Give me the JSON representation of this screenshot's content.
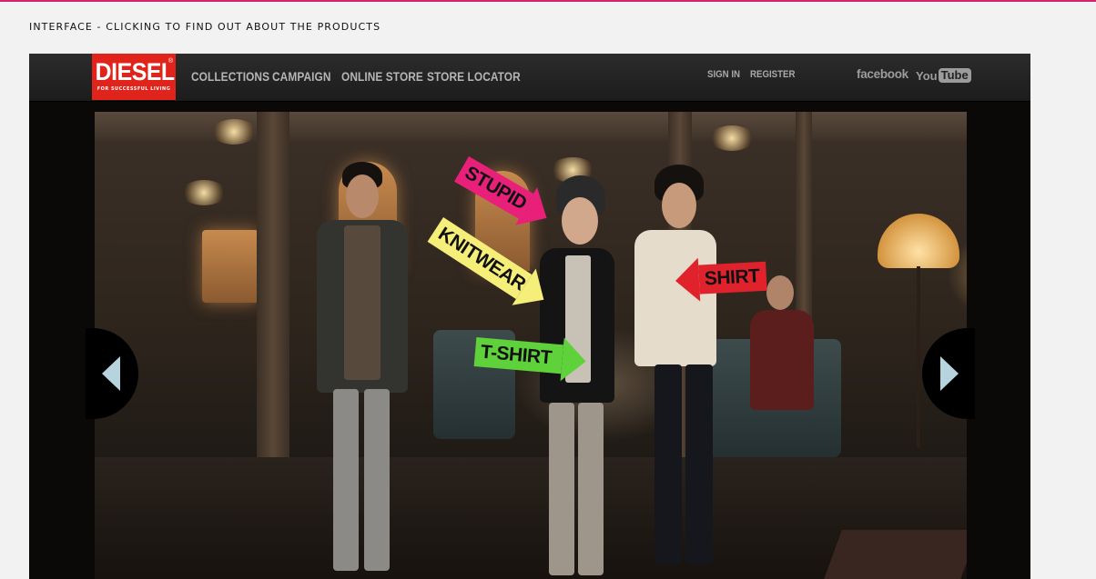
{
  "caption": "INTERFACE - CLICKING TO FIND OUT ABOUT THE PRODUCTS",
  "logo": {
    "brand": "DIESEL",
    "tagline": "FOR SUCCESSFUL LIVING",
    "registered": "®"
  },
  "nav": {
    "items": [
      "COLLECTIONS",
      "CAMPAIGN",
      "ONLINE STORE",
      "STORE LOCATOR"
    ],
    "sign_in": "SIGN IN",
    "register": "REGISTER",
    "facebook": "facebook",
    "youtube_you": "You",
    "youtube_tube": "Tube"
  },
  "product_tags": [
    {
      "label": "STUPID",
      "color": "#e8207a"
    },
    {
      "label": "KNITWEAR",
      "color": "#f5ef7a"
    },
    {
      "label": "SHIRT",
      "color": "#e0222c"
    },
    {
      "label": "T-SHIRT",
      "color": "#5fd13a"
    }
  ],
  "colors": {
    "accent_line": "#d4236e",
    "brand_red": "#e1241b"
  }
}
